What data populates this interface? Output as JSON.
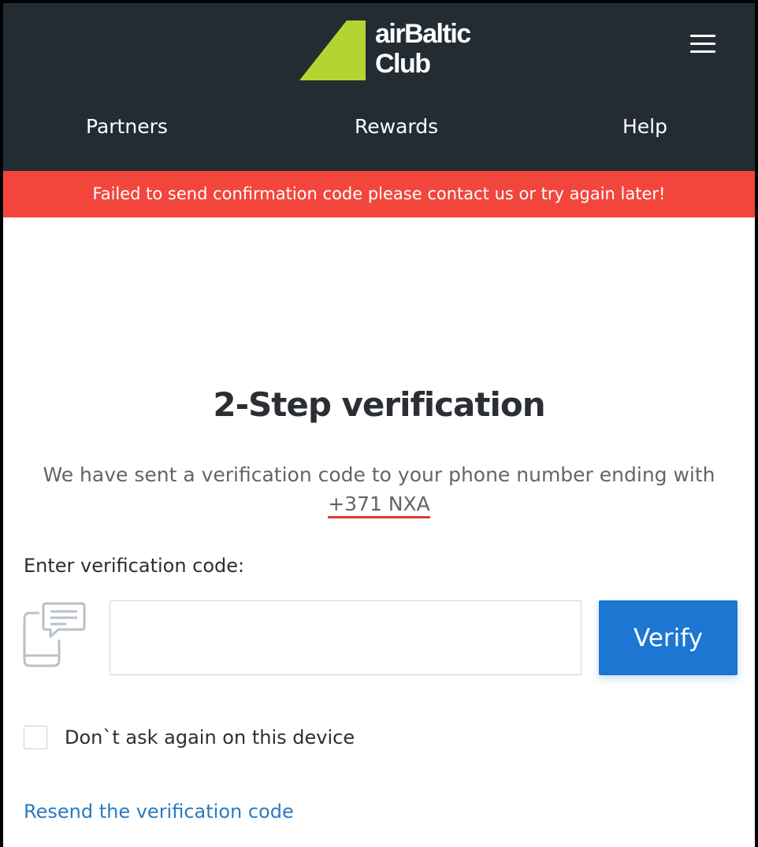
{
  "header": {
    "logo_line1": "airBaltic",
    "logo_line2": "Club",
    "nav": [
      "Partners",
      "Rewards",
      "Help"
    ]
  },
  "alert": {
    "message": "Failed to send confirmation code please contact us or try again later!",
    "color": "#f2463c"
  },
  "main": {
    "title": "2-Step verification",
    "description_prefix": "We have sent a verification code to your phone number ending with ",
    "phone": "+371 NXA",
    "code_label": "Enter verification code:",
    "code_value": "",
    "verify_label": "Verify",
    "remember_label": "Don`t ask again on this device",
    "remember_checked": false,
    "resend_label": "Resend the verification code"
  },
  "icons": {
    "menu": "hamburger-menu-icon",
    "sms": "phone-message-icon",
    "logo": "airbaltic-logo-icon"
  },
  "colors": {
    "header_bg": "#242c33",
    "brand_green": "#b4d432",
    "primary_blue": "#1c76d2",
    "link_blue": "#2a7bbf"
  }
}
